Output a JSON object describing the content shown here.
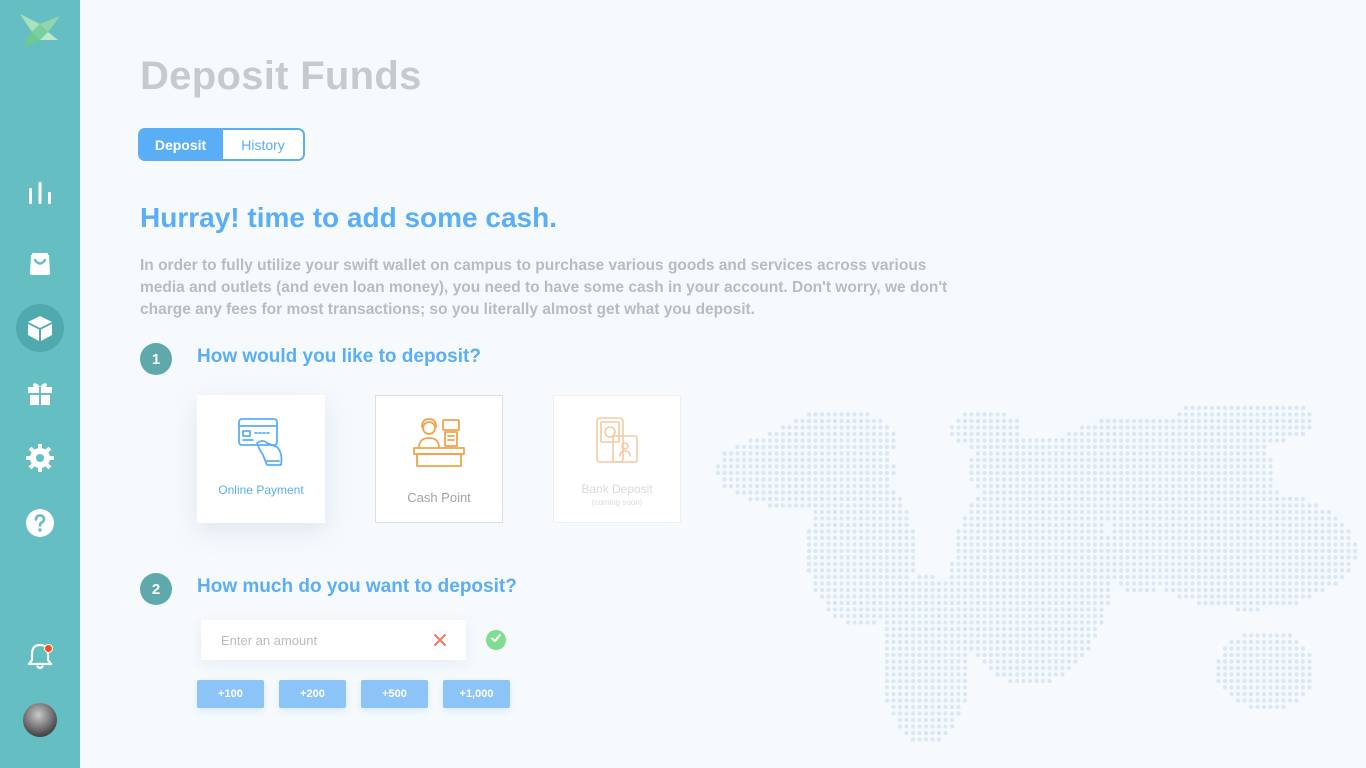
{
  "app": {
    "colors": {
      "sidebar": "#65bec2",
      "accent": "#5aaef5",
      "step_circle": "#5fa9ad",
      "notification_dot": "#f4511e",
      "confirm": "#7fdd92",
      "background": "#f6fafd"
    }
  },
  "sidebar": {
    "logo_icon": "bird-logo-icon",
    "items": [
      {
        "name": "analytics",
        "icon": "bar-chart-icon",
        "active": false
      },
      {
        "name": "shop",
        "icon": "shopping-bag-icon",
        "active": false
      },
      {
        "name": "deposit",
        "icon": "box-icon",
        "active": true
      },
      {
        "name": "rewards",
        "icon": "gift-icon",
        "active": false
      },
      {
        "name": "settings",
        "icon": "gear-icon",
        "active": false
      },
      {
        "name": "help",
        "icon": "question-icon",
        "active": false
      }
    ],
    "notifications_icon": "bell-icon",
    "has_unread_notifications": true,
    "avatar": "user-avatar"
  },
  "page": {
    "title": "Deposit Funds",
    "tabs": [
      {
        "label": "Deposit",
        "active": true
      },
      {
        "label": "History",
        "active": false
      }
    ],
    "headline": "Hurray! time to add some cash.",
    "intro": "In order to fully utilize your swift wallet on campus to purchase various goods and services across various media and outlets (and even loan money), you need to have some cash in your account. Don't worry, we don't charge any fees for most transactions; so you literally almost get what you deposit."
  },
  "step1": {
    "number": "1",
    "title": "How would you like to deposit?",
    "methods": [
      {
        "label": "Online Payment",
        "icon": "card-payment-icon",
        "selected": true
      },
      {
        "label": "Cash Point",
        "icon": "cashier-icon",
        "selected": false
      },
      {
        "label": "Bank Deposit",
        "sublabel": "(coming soon)",
        "icon": "bank-deposit-icon",
        "disabled": true
      }
    ]
  },
  "step2": {
    "number": "2",
    "title": "How much do you want to deposit?",
    "amount": {
      "value": "",
      "placeholder": "Enter an amount"
    },
    "quick_amounts": [
      "+100",
      "+200",
      "+500",
      "+1,000"
    ]
  }
}
